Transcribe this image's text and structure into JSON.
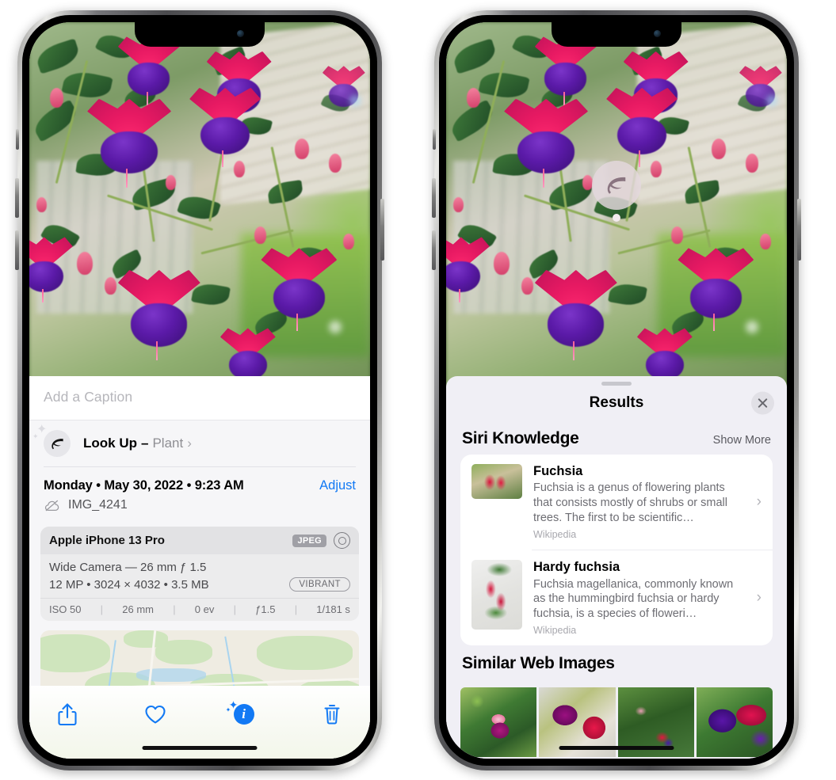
{
  "left_phone": {
    "name": "iPhone showing Photos info panel",
    "caption_placeholder": "Add a Caption",
    "lookup": {
      "label": "Look Up",
      "dash": "–",
      "subject": "Plant",
      "chevron": "›",
      "icon": "leaf-icon"
    },
    "meta": {
      "date": "Monday • May 30, 2022 • 9:23 AM",
      "adjust": "Adjust",
      "filename": "IMG_4241",
      "cloud_icon": "icloud-slash-icon"
    },
    "camera_card": {
      "device": "Apple iPhone 13 Pro",
      "format_tag": "JPEG",
      "raw_icon": "raw-circle-icon",
      "lens": "Wide Camera — 26 mm ƒ 1.5",
      "specs": "12 MP • 3024 × 4032 • 3.5 MB",
      "style_pill": "VIBRANT",
      "exif": [
        "ISO 50",
        "26 mm",
        "0 ev",
        "ƒ1.5",
        "1/181 s"
      ]
    },
    "toolbar": [
      {
        "name": "share-button",
        "icon": "share-icon"
      },
      {
        "name": "favorite-button",
        "icon": "heart-icon"
      },
      {
        "name": "info-button",
        "icon": "info-sparkle-icon"
      },
      {
        "name": "delete-button",
        "icon": "trash-icon"
      }
    ]
  },
  "right_phone": {
    "name": "iPhone showing Visual Look Up results",
    "photo_badge_icon": "leaf-icon",
    "sheet": {
      "title": "Results",
      "close_icon": "close-icon",
      "sections": [
        {
          "title": "Siri Knowledge",
          "action": "Show More",
          "items": [
            {
              "title": "Fuchsia",
              "description": "Fuchsia is a genus of flowering plants that consists mostly of shrubs or small trees. The first to be scientific…",
              "source": "Wikipedia",
              "thumb": "fuchsia-red-bells-photo"
            },
            {
              "title": "Hardy fuchsia",
              "description": "Fuchsia magellanica, commonly known as the hummingbird fuchsia or hardy fuchsia, is a species of floweri…",
              "source": "Wikipedia",
              "thumb": "hardy-fuchsia-branch-photo"
            }
          ]
        },
        {
          "title": "Similar Web Images",
          "images": [
            {
              "name": "web-image-1",
              "alt": "pink and magenta fuchsia with green leaves"
            },
            {
              "name": "web-image-2",
              "alt": "red and magenta fuchsia close-up"
            },
            {
              "name": "web-image-3",
              "alt": "fuchsia shrub with many buds"
            },
            {
              "name": "web-image-4",
              "alt": "purple and red fuchsia blooms"
            }
          ]
        }
      ]
    }
  },
  "colors": {
    "accent_blue": "#1279f4",
    "sheet_bg": "#f0eff5",
    "card_bg": "#ffffff",
    "secondary_text": "#8e8e93",
    "photo_pink": "#e81a63",
    "photo_purple": "#5b1aa8"
  }
}
